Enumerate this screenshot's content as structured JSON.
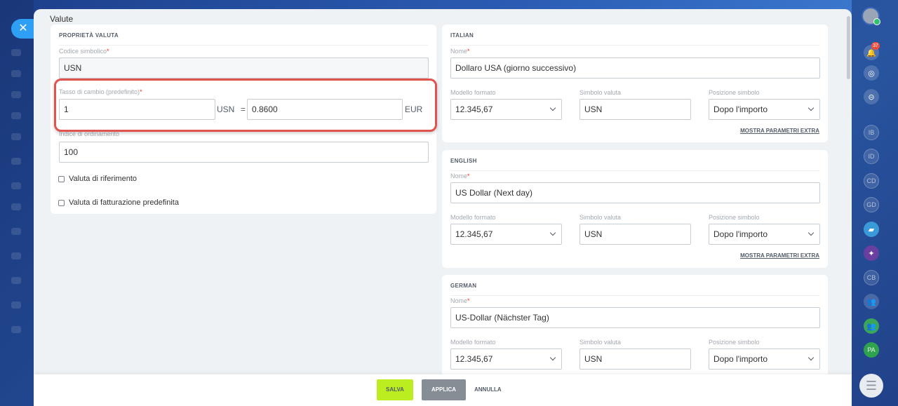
{
  "window": {
    "title": "Valute",
    "close_glyph": "✕"
  },
  "left_card": {
    "title": "PROPRIETÀ VALUTA",
    "code": {
      "label": "Codice simbolico",
      "value": "USN"
    },
    "rate": {
      "label": "Tasso di cambio (predefinito)",
      "amount": "1",
      "unit_left": "USN",
      "equals": "=",
      "value": "0.8600",
      "unit_right": "EUR"
    },
    "sort": {
      "label": "Indice di ordinamento",
      "value": "100"
    },
    "checkboxes": [
      {
        "label": "Valuta di riferimento",
        "checked": false
      },
      {
        "label": "Valuta di fatturazione predefinita",
        "checked": false
      }
    ]
  },
  "languages": [
    {
      "title": "ITALIAN",
      "name_label": "Nome",
      "name": "Dollaro USA (giorno successivo)",
      "format_label": "Modello formato",
      "format": "12.345,67",
      "symbol_label": "Simbolo valuta",
      "symbol": "USN",
      "position_label": "Posizione simbolo",
      "position": "Dopo l'importo",
      "extra_link": "MOSTRA PARAMETRI EXTRA"
    },
    {
      "title": "ENGLISH",
      "name_label": "Nome",
      "name": "US Dollar (Next day)",
      "format_label": "Modello formato",
      "format": "12.345,67",
      "symbol_label": "Simbolo valuta",
      "symbol": "USN",
      "position_label": "Posizione simbolo",
      "position": "Dopo l'importo",
      "extra_link": "MOSTRA PARAMETRI EXTRA"
    },
    {
      "title": "GERMAN",
      "name_label": "Nome",
      "name": "US-Dollar (Nächster Tag)",
      "format_label": "Modello formato",
      "format": "12.345,67",
      "symbol_label": "Simbolo valuta",
      "symbol": "USN",
      "position_label": "Posizione simbolo",
      "position": "Dopo l'importo"
    }
  ],
  "footer": {
    "save": "SALVA",
    "apply": "APPLICA",
    "cancel": "ANNULLA"
  },
  "sidebar": {
    "notification_count": "37",
    "items": [
      {
        "label": "IB"
      },
      {
        "label": "ID"
      },
      {
        "label": "CD"
      },
      {
        "label": "GD"
      },
      {
        "label": "CB"
      },
      {
        "label": "PA"
      }
    ],
    "chat_glyph": "☰"
  },
  "colors": {
    "accent": "#2f9ff5",
    "save": "#bbed21",
    "highlight": "#e0534e"
  }
}
